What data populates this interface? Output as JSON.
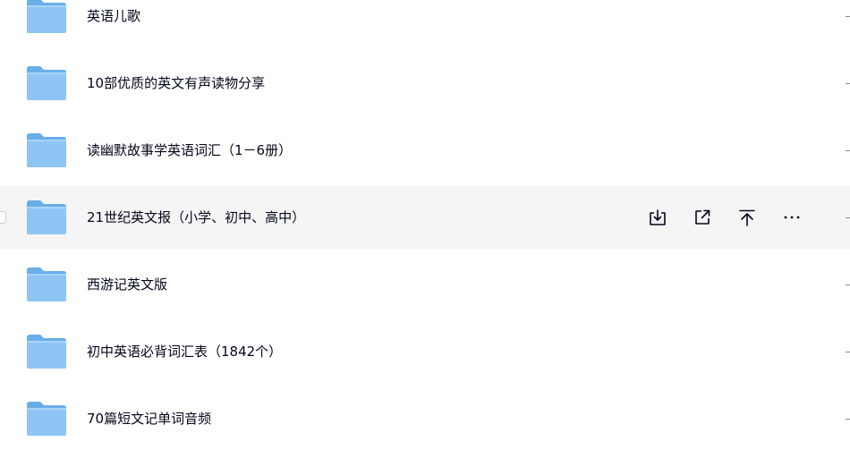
{
  "files": [
    {
      "name": "英语儿歌",
      "icon": "folder-icon",
      "hovered": false
    },
    {
      "name": "10部优质的英文有声读物分享",
      "icon": "folder-icon",
      "hovered": false
    },
    {
      "name": "读幽默故事学英语词汇（1－6册）",
      "icon": "folder-icon",
      "hovered": false
    },
    {
      "name": "21世纪英文报（小学、初中、高中）",
      "icon": "folder-icon",
      "hovered": true
    },
    {
      "name": "西游记英文版",
      "icon": "folder-icon",
      "hovered": false
    },
    {
      "name": "初中英语必背词汇表（1842个）",
      "icon": "folder-icon",
      "hovered": false
    },
    {
      "name": "70篇短文记单词音频",
      "icon": "folder-icon",
      "hovered": false
    }
  ],
  "row_actions": {
    "download": "download-icon",
    "share": "share-icon",
    "pin_top": "pin-to-top-icon",
    "more": "more-icon"
  },
  "colors": {
    "hover_bg": "#f5f5f6",
    "text": "#03081a",
    "folder_front": "#8ec5f5",
    "folder_back": "#6aaee9"
  }
}
